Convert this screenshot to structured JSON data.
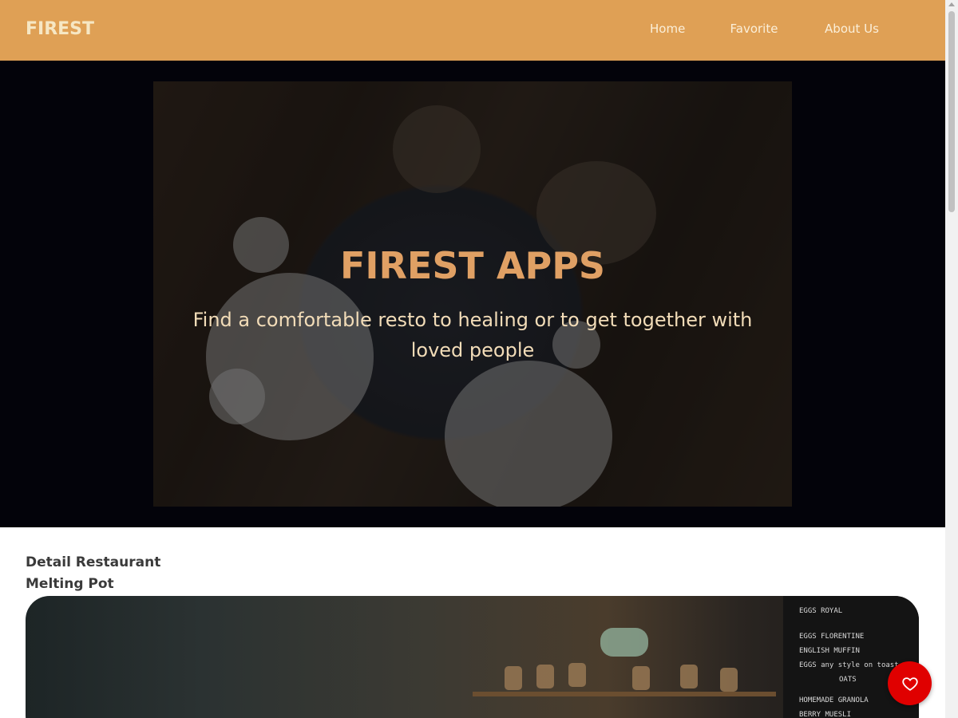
{
  "header": {
    "brand": "FIREST",
    "nav": [
      {
        "label": "Home"
      },
      {
        "label": "Favorite"
      },
      {
        "label": "About Us"
      }
    ],
    "background_color": "#dfa055"
  },
  "hero": {
    "title": "FIREST APPS",
    "subtitle": "Find a comfortable resto to healing or to get together with loved people",
    "title_color": "#e0a064",
    "background_color": "#03030a"
  },
  "detail": {
    "section_heading": "Detail Restaurant",
    "restaurant_name": "Melting Pot",
    "menu_board_lines": [
      "EGGS ROYAL",
      "EGGS FLORENTINE",
      "ENGLISH MUFFIN",
      "EGGS any style on toast",
      "OATS",
      "HOMEMADE GRANOLA",
      "BERRY MUESLI"
    ]
  },
  "favorite_button": {
    "icon": "heart-outline-icon",
    "color": "#e00000"
  }
}
